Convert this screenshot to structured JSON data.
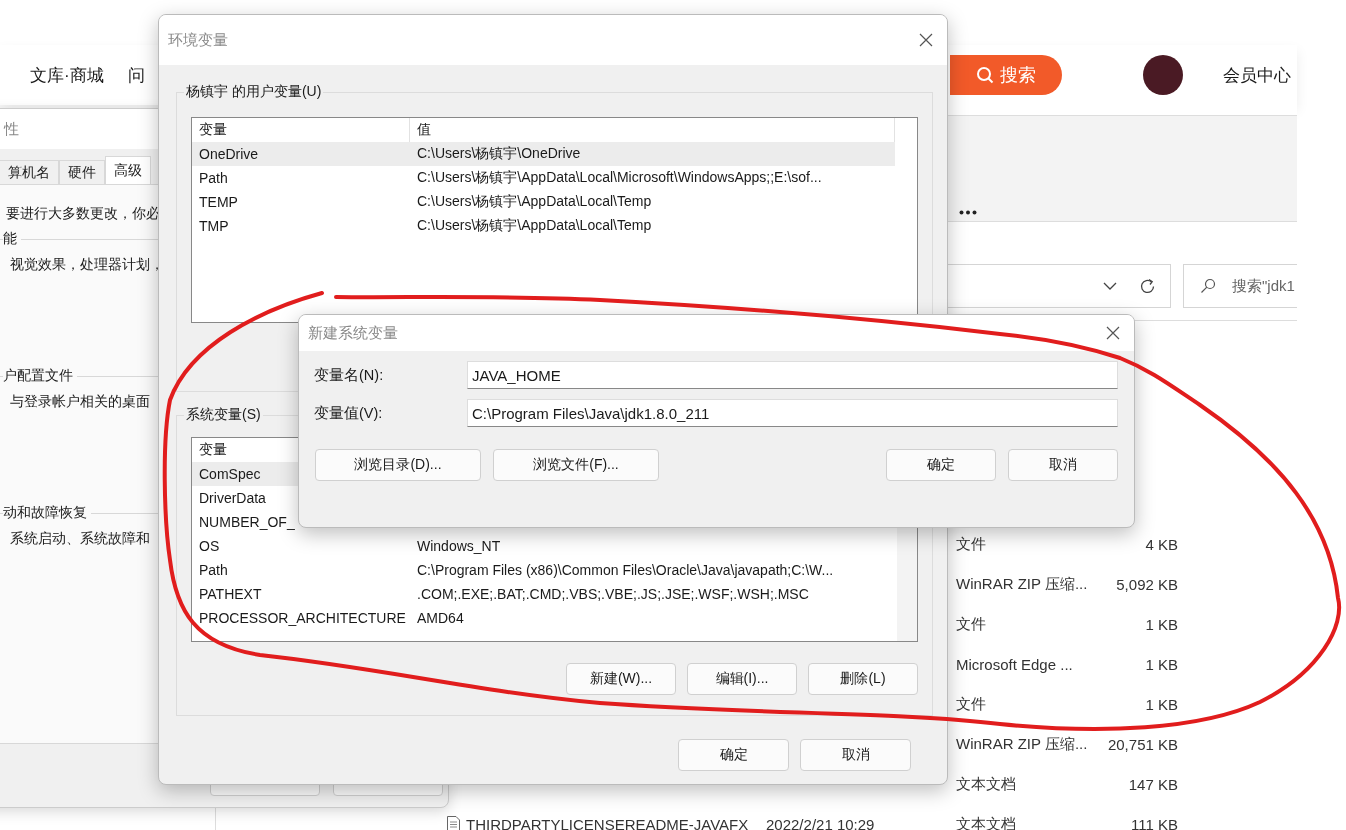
{
  "browser": {
    "nav": [
      {
        "label": "文库·商城"
      },
      {
        "label": "问"
      }
    ],
    "search_button": "搜索",
    "member_link": "会员中心"
  },
  "explorer": {
    "search_placeholder": "搜索\"jdk1",
    "files": [
      {
        "type": "文件",
        "size": "4 KB"
      },
      {
        "type": "WinRAR ZIP 压缩...",
        "size": "5,092 KB"
      },
      {
        "type": "文件",
        "size": "1 KB"
      },
      {
        "type": "Microsoft Edge ...",
        "size": "1 KB"
      },
      {
        "type": "文件",
        "size": "1 KB"
      },
      {
        "type": "WinRAR ZIP 压缩...",
        "size": "20,751 KB"
      },
      {
        "type": "文本文档",
        "size": "147 KB"
      },
      {
        "name": "THIRDPARTYLICENSEREADME-JAVAFX",
        "date": "2022/2/21 10:29",
        "type": "文本文档",
        "size": "111 KB"
      }
    ]
  },
  "system_properties": {
    "title": "性",
    "tabs": [
      {
        "label": "算机名",
        "selected": false
      },
      {
        "label": "硬件",
        "selected": false
      },
      {
        "label": "高级",
        "selected": true
      }
    ],
    "intro": "要进行大多数更改，你必",
    "groups": [
      {
        "heading": "能",
        "text": "视觉效果，处理器计划，"
      },
      {
        "heading": "户配置文件",
        "text": "与登录帐户相关的桌面"
      },
      {
        "heading": "动和故障恢复",
        "text": "系统启动、系统故障和"
      }
    ]
  },
  "env_dialog": {
    "title": "环境变量",
    "user_group": "杨镇宇 的用户变量(U)",
    "user_columns": [
      "变量",
      "值"
    ],
    "user_rows": [
      {
        "name": "OneDrive",
        "value": "C:\\Users\\杨镇宇\\OneDrive",
        "selected": true
      },
      {
        "name": "Path",
        "value": "C:\\Users\\杨镇宇\\AppData\\Local\\Microsoft\\WindowsApps;;E:\\sof...",
        "selected": false
      },
      {
        "name": "TEMP",
        "value": "C:\\Users\\杨镇宇\\AppData\\Local\\Temp",
        "selected": false
      },
      {
        "name": "TMP",
        "value": "C:\\Users\\杨镇宇\\AppData\\Local\\Temp",
        "selected": false
      }
    ],
    "system_group": "系统变量(S)",
    "system_columns": [
      "变量"
    ],
    "system_rows": [
      {
        "name": "ComSpec",
        "selected": true
      },
      {
        "name": "DriverData",
        "selected": false
      },
      {
        "name": "NUMBER_OF_",
        "selected": false
      },
      {
        "name": "OS",
        "value": "Windows_NT",
        "selected": false
      },
      {
        "name": "Path",
        "value": "C:\\Program Files (x86)\\Common Files\\Oracle\\Java\\javapath;C:\\W...",
        "selected": false
      },
      {
        "name": "PATHEXT",
        "value": ".COM;.EXE;.BAT;.CMD;.VBS;.VBE;.JS;.JSE;.WSF;.WSH;.MSC",
        "selected": false
      },
      {
        "name": "PROCESSOR_ARCHITECTURE",
        "value": "AMD64",
        "selected": false
      }
    ],
    "system_buttons": [
      "新建(W)...",
      "编辑(I)...",
      "删除(L)"
    ],
    "buttons": [
      "确定",
      "取消"
    ]
  },
  "new_variable_dialog": {
    "title": "新建系统变量",
    "fields": [
      {
        "label": "变量名(N):",
        "value": "JAVA_HOME"
      },
      {
        "label": "变量值(V):",
        "value": "C:\\Program Files\\Java\\jdk1.8.0_211"
      }
    ],
    "browse_buttons": [
      "浏览目录(D)...",
      "浏览文件(F)..."
    ],
    "buttons": [
      "确定",
      "取消"
    ]
  }
}
